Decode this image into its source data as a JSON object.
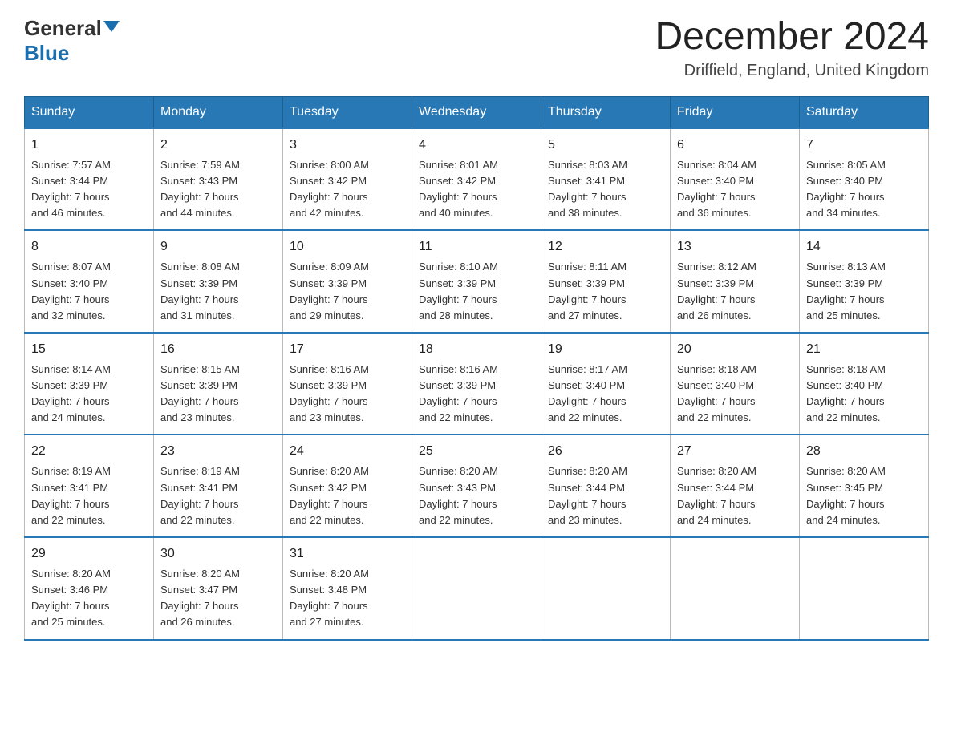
{
  "header": {
    "logo_general": "General",
    "logo_blue": "Blue",
    "month_title": "December 2024",
    "location": "Driffield, England, United Kingdom"
  },
  "weekdays": [
    "Sunday",
    "Monday",
    "Tuesday",
    "Wednesday",
    "Thursday",
    "Friday",
    "Saturday"
  ],
  "weeks": [
    [
      {
        "day": "1",
        "sunrise": "7:57 AM",
        "sunset": "3:44 PM",
        "daylight": "7 hours and 46 minutes."
      },
      {
        "day": "2",
        "sunrise": "7:59 AM",
        "sunset": "3:43 PM",
        "daylight": "7 hours and 44 minutes."
      },
      {
        "day": "3",
        "sunrise": "8:00 AM",
        "sunset": "3:42 PM",
        "daylight": "7 hours and 42 minutes."
      },
      {
        "day": "4",
        "sunrise": "8:01 AM",
        "sunset": "3:42 PM",
        "daylight": "7 hours and 40 minutes."
      },
      {
        "day": "5",
        "sunrise": "8:03 AM",
        "sunset": "3:41 PM",
        "daylight": "7 hours and 38 minutes."
      },
      {
        "day": "6",
        "sunrise": "8:04 AM",
        "sunset": "3:40 PM",
        "daylight": "7 hours and 36 minutes."
      },
      {
        "day": "7",
        "sunrise": "8:05 AM",
        "sunset": "3:40 PM",
        "daylight": "7 hours and 34 minutes."
      }
    ],
    [
      {
        "day": "8",
        "sunrise": "8:07 AM",
        "sunset": "3:40 PM",
        "daylight": "7 hours and 32 minutes."
      },
      {
        "day": "9",
        "sunrise": "8:08 AM",
        "sunset": "3:39 PM",
        "daylight": "7 hours and 31 minutes."
      },
      {
        "day": "10",
        "sunrise": "8:09 AM",
        "sunset": "3:39 PM",
        "daylight": "7 hours and 29 minutes."
      },
      {
        "day": "11",
        "sunrise": "8:10 AM",
        "sunset": "3:39 PM",
        "daylight": "7 hours and 28 minutes."
      },
      {
        "day": "12",
        "sunrise": "8:11 AM",
        "sunset": "3:39 PM",
        "daylight": "7 hours and 27 minutes."
      },
      {
        "day": "13",
        "sunrise": "8:12 AM",
        "sunset": "3:39 PM",
        "daylight": "7 hours and 26 minutes."
      },
      {
        "day": "14",
        "sunrise": "8:13 AM",
        "sunset": "3:39 PM",
        "daylight": "7 hours and 25 minutes."
      }
    ],
    [
      {
        "day": "15",
        "sunrise": "8:14 AM",
        "sunset": "3:39 PM",
        "daylight": "7 hours and 24 minutes."
      },
      {
        "day": "16",
        "sunrise": "8:15 AM",
        "sunset": "3:39 PM",
        "daylight": "7 hours and 23 minutes."
      },
      {
        "day": "17",
        "sunrise": "8:16 AM",
        "sunset": "3:39 PM",
        "daylight": "7 hours and 23 minutes."
      },
      {
        "day": "18",
        "sunrise": "8:16 AM",
        "sunset": "3:39 PM",
        "daylight": "7 hours and 22 minutes."
      },
      {
        "day": "19",
        "sunrise": "8:17 AM",
        "sunset": "3:40 PM",
        "daylight": "7 hours and 22 minutes."
      },
      {
        "day": "20",
        "sunrise": "8:18 AM",
        "sunset": "3:40 PM",
        "daylight": "7 hours and 22 minutes."
      },
      {
        "day": "21",
        "sunrise": "8:18 AM",
        "sunset": "3:40 PM",
        "daylight": "7 hours and 22 minutes."
      }
    ],
    [
      {
        "day": "22",
        "sunrise": "8:19 AM",
        "sunset": "3:41 PM",
        "daylight": "7 hours and 22 minutes."
      },
      {
        "day": "23",
        "sunrise": "8:19 AM",
        "sunset": "3:41 PM",
        "daylight": "7 hours and 22 minutes."
      },
      {
        "day": "24",
        "sunrise": "8:20 AM",
        "sunset": "3:42 PM",
        "daylight": "7 hours and 22 minutes."
      },
      {
        "day": "25",
        "sunrise": "8:20 AM",
        "sunset": "3:43 PM",
        "daylight": "7 hours and 22 minutes."
      },
      {
        "day": "26",
        "sunrise": "8:20 AM",
        "sunset": "3:44 PM",
        "daylight": "7 hours and 23 minutes."
      },
      {
        "day": "27",
        "sunrise": "8:20 AM",
        "sunset": "3:44 PM",
        "daylight": "7 hours and 24 minutes."
      },
      {
        "day": "28",
        "sunrise": "8:20 AM",
        "sunset": "3:45 PM",
        "daylight": "7 hours and 24 minutes."
      }
    ],
    [
      {
        "day": "29",
        "sunrise": "8:20 AM",
        "sunset": "3:46 PM",
        "daylight": "7 hours and 25 minutes."
      },
      {
        "day": "30",
        "sunrise": "8:20 AM",
        "sunset": "3:47 PM",
        "daylight": "7 hours and 26 minutes."
      },
      {
        "day": "31",
        "sunrise": "8:20 AM",
        "sunset": "3:48 PM",
        "daylight": "7 hours and 27 minutes."
      },
      null,
      null,
      null,
      null
    ]
  ],
  "labels": {
    "sunrise": "Sunrise:",
    "sunset": "Sunset:",
    "daylight": "Daylight:"
  }
}
